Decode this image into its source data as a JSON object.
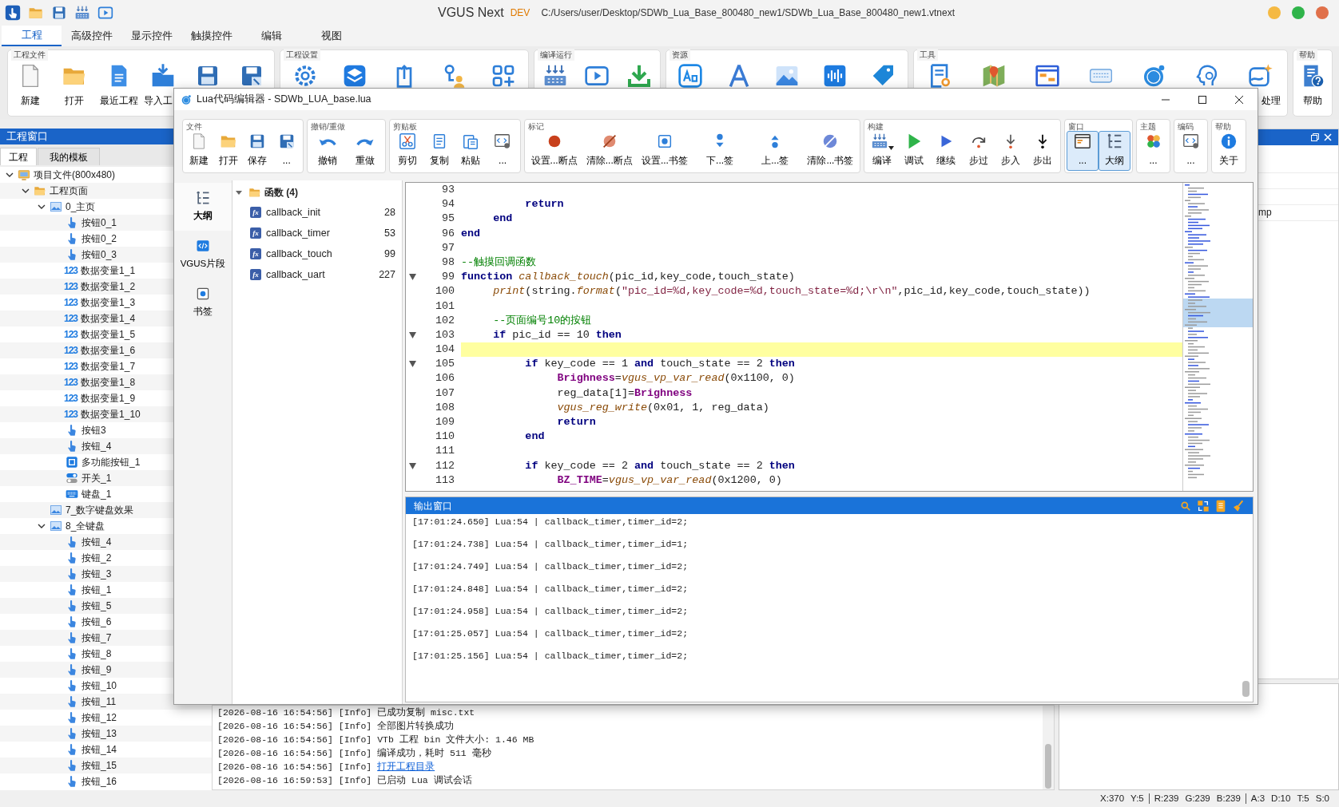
{
  "app": {
    "title": "VGUS Next",
    "badge": "DEV",
    "path": "C:/Users/user/Desktop/SDWb_Lua_Base_800480_new1/SDWb_Lua_Base_800480_new1.vtnext"
  },
  "menu_tabs": [
    {
      "label": "工程",
      "selected": true
    },
    {
      "label": "高级控件",
      "selected": false
    },
    {
      "label": "显示控件",
      "selected": false
    },
    {
      "label": "触摸控件",
      "selected": false
    },
    {
      "label": "编辑",
      "selected": false
    },
    {
      "label": "视图",
      "selected": false
    }
  ],
  "ribbon": [
    {
      "title": "工程文件",
      "buttons": [
        {
          "kind": "labeled",
          "label": "新建"
        },
        {
          "kind": "labeled",
          "label": "打开"
        },
        {
          "kind": "labeled",
          "label": "最近工程"
        },
        {
          "kind": "labeled",
          "label": "导入工"
        },
        {
          "kind": "icon"
        },
        {
          "kind": "icon"
        }
      ]
    },
    {
      "title": "工程设置",
      "buttons": [
        {
          "kind": "icon"
        },
        {
          "kind": "icon"
        },
        {
          "kind": "icon"
        },
        {
          "kind": "icon"
        },
        {
          "kind": "icon"
        }
      ]
    },
    {
      "title": "编译运行",
      "buttons": [
        {
          "kind": "icon"
        },
        {
          "kind": "icon"
        },
        {
          "kind": "icon"
        }
      ]
    },
    {
      "title": "资源",
      "buttons": [
        {
          "kind": "icon"
        },
        {
          "kind": "icon"
        },
        {
          "kind": "icon"
        },
        {
          "kind": "icon"
        },
        {
          "kind": "icon"
        }
      ]
    },
    {
      "title": "工具",
      "buttons": [
        {
          "kind": "icon"
        },
        {
          "kind": "icon"
        },
        {
          "kind": "icon"
        },
        {
          "kind": "icon"
        },
        {
          "kind": "icon"
        },
        {
          "kind": "icon"
        },
        {
          "kind": "labeled",
          "label": "处理"
        }
      ]
    },
    {
      "title": "帮助",
      "buttons": [
        {
          "kind": "labeled",
          "label": "帮助"
        }
      ]
    }
  ],
  "project_panel": {
    "title": "工程窗口",
    "tabs": [
      {
        "label": "工程",
        "selected": true
      },
      {
        "label": "我的模板",
        "selected": false
      }
    ],
    "tree": [
      {
        "kind": "project",
        "label": "项目文件(800x480)",
        "expanded": true,
        "children": [
          {
            "kind": "folder",
            "label": "工程页面",
            "expanded": true,
            "children": [
              {
                "kind": "page",
                "label": "0_主页",
                "expanded": true,
                "children": [
                  {
                    "kind": "button",
                    "label": "按钮0_1"
                  },
                  {
                    "kind": "button",
                    "label": "按钮0_2"
                  },
                  {
                    "kind": "button",
                    "label": "按钮0_3"
                  },
                  {
                    "kind": "number",
                    "badge": "123",
                    "label": "数据变量1_1"
                  },
                  {
                    "kind": "number",
                    "badge": "123",
                    "label": "数据变量1_2"
                  },
                  {
                    "kind": "number",
                    "badge": "123",
                    "label": "数据变量1_3"
                  },
                  {
                    "kind": "number",
                    "badge": "123",
                    "label": "数据变量1_4"
                  },
                  {
                    "kind": "number",
                    "badge": "123",
                    "label": "数据变量1_5"
                  },
                  {
                    "kind": "number",
                    "badge": "123",
                    "label": "数据变量1_6"
                  },
                  {
                    "kind": "number",
                    "badge": "123",
                    "label": "数据变量1_7"
                  },
                  {
                    "kind": "number",
                    "badge": "123",
                    "label": "数据变量1_8"
                  },
                  {
                    "kind": "number",
                    "badge": "123",
                    "label": "数据变量1_9"
                  },
                  {
                    "kind": "number",
                    "badge": "123",
                    "label": "数据变量1_10"
                  },
                  {
                    "kind": "button",
                    "label": "按钮3"
                  },
                  {
                    "kind": "button",
                    "label": "按钮_4"
                  },
                  {
                    "kind": "multi",
                    "label": "多功能按钮_1"
                  },
                  {
                    "kind": "switch",
                    "label": "开关_1"
                  },
                  {
                    "kind": "keyboard",
                    "label": "键盘_1"
                  }
                ]
              },
              {
                "kind": "page",
                "label": "7_数字键盘效果"
              },
              {
                "kind": "page",
                "label": "8_全键盘",
                "expanded": true,
                "children": [
                  {
                    "kind": "button",
                    "label": "按钮_4"
                  },
                  {
                    "kind": "button",
                    "label": "按钮_2"
                  },
                  {
                    "kind": "button",
                    "label": "按钮_3"
                  },
                  {
                    "kind": "button",
                    "label": "按钮_1"
                  },
                  {
                    "kind": "button",
                    "label": "按钮_5"
                  },
                  {
                    "kind": "button",
                    "label": "按钮_6"
                  },
                  {
                    "kind": "button",
                    "label": "按钮_7"
                  },
                  {
                    "kind": "button",
                    "label": "按钮_8"
                  },
                  {
                    "kind": "button",
                    "label": "按钮_9"
                  },
                  {
                    "kind": "button",
                    "label": "按钮_10"
                  },
                  {
                    "kind": "button",
                    "label": "按钮_11"
                  },
                  {
                    "kind": "button",
                    "label": "按钮_12"
                  },
                  {
                    "kind": "button",
                    "label": "按钮_13"
                  },
                  {
                    "kind": "button",
                    "label": "按钮_14"
                  },
                  {
                    "kind": "button",
                    "label": "按钮_15"
                  },
                  {
                    "kind": "button",
                    "label": "按钮_16"
                  }
                ]
              }
            ]
          }
        ]
      }
    ]
  },
  "properties_panel": {
    "rows": [
      {
        "value": "mp"
      }
    ]
  },
  "log": [
    {
      "kind": "text",
      "time": "[2026-08-16 16:54:56]",
      "level": "[Info]",
      "text": "已成功复制 misc.txt"
    },
    {
      "kind": "text",
      "time": "[2026-08-16 16:54:56]",
      "level": "[Info]",
      "text": "全部图片转换成功"
    },
    {
      "kind": "text",
      "time": "[2026-08-16 16:54:56]",
      "level": "[Info]",
      "text": "VTb 工程 bin 文件大小: 1.46 MB"
    },
    {
      "kind": "text",
      "time": "[2026-08-16 16:54:56]",
      "level": "[Info]",
      "text": "编译成功，耗时 511 毫秒"
    },
    {
      "kind": "link",
      "time": "[2026-08-16 16:54:56]",
      "level": "[Info]",
      "text": "打开工程目录"
    },
    {
      "kind": "text",
      "time": "[2026-08-16 16:59:53]",
      "level": "[Info]",
      "text": "已启动 Lua 调试会话"
    }
  ],
  "status_bar": [
    {
      "items": [
        "X:370",
        "Y:5"
      ]
    },
    {
      "items": [
        "R:239",
        "G:239",
        "B:239"
      ]
    },
    {
      "items": [
        "A:3",
        "D:10",
        "T:5",
        "S:0"
      ]
    }
  ],
  "editor": {
    "title": "Lua代码编辑器 - SDWb_LUA_base.lua",
    "toolbar": [
      {
        "title": "文件",
        "buttons": [
          {
            "label": "新建"
          },
          {
            "label": "打开"
          },
          {
            "label": "保存"
          },
          {
            "label": "..."
          }
        ]
      },
      {
        "title": "撤销/重做",
        "buttons": [
          {
            "label": "撤销"
          },
          {
            "label": "重做"
          }
        ]
      },
      {
        "title": "剪贴板",
        "buttons": [
          {
            "label": "剪切"
          },
          {
            "label": "复制"
          },
          {
            "label": "粘贴"
          },
          {
            "label": "..."
          }
        ]
      },
      {
        "title": "标记",
        "buttons": [
          {
            "label": "设置...断点"
          },
          {
            "label": "清除...断点"
          },
          {
            "label": "设置...书签"
          },
          {
            "label": "下...签"
          },
          {
            "label": "上...签"
          },
          {
            "label": "清除...书签"
          }
        ]
      },
      {
        "title": "构建",
        "buttons": [
          {
            "label": "编译",
            "kind": "split"
          },
          {
            "label": "调试",
            "kind": "plain"
          },
          {
            "label": "继续",
            "kind": "plain"
          },
          {
            "label": "步过",
            "kind": "plain"
          },
          {
            "label": "步入",
            "kind": "plain"
          },
          {
            "label": "步出",
            "kind": "plain"
          }
        ]
      },
      {
        "title": "窗口",
        "buttons": [
          {
            "label": "...",
            "selected": true
          },
          {
            "label": "大纲",
            "selected": true
          }
        ]
      },
      {
        "title": "主题",
        "buttons": [
          {
            "label": "..."
          }
        ]
      },
      {
        "title": "编码",
        "buttons": [
          {
            "label": "..."
          }
        ]
      },
      {
        "title": "帮助",
        "buttons": [
          {
            "label": "关于"
          }
        ]
      }
    ],
    "side_tabs": [
      {
        "label": "大纲",
        "selected": true
      },
      {
        "label": "VGUS片段",
        "selected": false
      },
      {
        "label": "书签",
        "selected": false
      }
    ],
    "outline": {
      "label": "函数 (4)",
      "expanded": true,
      "items": [
        {
          "badge": "fx",
          "name": "callback_init",
          "line": "28"
        },
        {
          "badge": "fx",
          "name": "callback_timer",
          "line": "53"
        },
        {
          "badge": "fx",
          "name": "callback_touch",
          "line": "99"
        },
        {
          "badge": "fx",
          "name": "callback_uart",
          "line": "227"
        }
      ]
    },
    "code": [
      {
        "number": "93",
        "foldable": false,
        "current": false
      },
      {
        "number": "94",
        "foldable": false,
        "current": false,
        "tokens": [
          {
            "kind": "keyword",
            "text": "          return"
          }
        ]
      },
      {
        "number": "95",
        "foldable": false,
        "current": false,
        "tokens": [
          {
            "kind": "keyword",
            "text": "     end"
          }
        ]
      },
      {
        "number": "96",
        "foldable": false,
        "current": false,
        "tokens": [
          {
            "kind": "keyword",
            "text": "end"
          }
        ]
      },
      {
        "number": "97",
        "foldable": false,
        "current": false
      },
      {
        "number": "98",
        "foldable": false,
        "current": false,
        "tokens": [
          {
            "kind": "comment",
            "text": "--触摸回调函数"
          }
        ]
      },
      {
        "number": "99",
        "foldable": true,
        "current": false,
        "tokens": [
          {
            "kind": "keyword",
            "text": "function "
          },
          {
            "kind": "function",
            "text": "callback_touch"
          },
          {
            "kind": "plain",
            "text": "(pic_id,key_code,touch_state)"
          }
        ]
      },
      {
        "number": "100",
        "foldable": false,
        "current": false,
        "tokens": [
          {
            "kind": "function",
            "text": "     print"
          },
          {
            "kind": "plain",
            "text": "(string."
          },
          {
            "kind": "function",
            "text": "format"
          },
          {
            "kind": "plain",
            "text": "("
          },
          {
            "kind": "string",
            "text": "\"pic_id=%d,key_code=%d,touch_state=%d;\\r\\n\""
          },
          {
            "kind": "plain",
            "text": ",pic_id,key_code,touch_state))"
          }
        ]
      },
      {
        "number": "101",
        "foldable": false,
        "current": false
      },
      {
        "number": "102",
        "foldable": false,
        "current": false,
        "tokens": [
          {
            "kind": "comment",
            "text": "     --页面编号10的按钮"
          }
        ]
      },
      {
        "number": "103",
        "foldable": true,
        "current": false,
        "tokens": [
          {
            "kind": "keyword",
            "text": "     if"
          },
          {
            "kind": "plain",
            "text": " pic_id == 10 "
          },
          {
            "kind": "keyword",
            "text": "then"
          }
        ]
      },
      {
        "number": "104",
        "foldable": false,
        "current": true
      },
      {
        "number": "105",
        "foldable": true,
        "current": false,
        "tokens": [
          {
            "kind": "keyword",
            "text": "          if"
          },
          {
            "kind": "plain",
            "text": " key_code == 1 "
          },
          {
            "kind": "keyword",
            "text": "and"
          },
          {
            "kind": "plain",
            "text": " touch_state == 2 "
          },
          {
            "kind": "keyword",
            "text": "then"
          }
        ]
      },
      {
        "number": "106",
        "foldable": false,
        "current": false,
        "tokens": [
          {
            "kind": "variable",
            "text": "               Brighness"
          },
          {
            "kind": "plain",
            "text": "="
          },
          {
            "kind": "function",
            "text": "vgus_vp_var_read"
          },
          {
            "kind": "plain",
            "text": "(0x1100, 0)"
          }
        ]
      },
      {
        "number": "107",
        "foldable": false,
        "current": false,
        "tokens": [
          {
            "kind": "plain",
            "text": "               reg_data[1]="
          },
          {
            "kind": "variable",
            "text": "Brighness"
          }
        ]
      },
      {
        "number": "108",
        "foldable": false,
        "current": false,
        "tokens": [
          {
            "kind": "function",
            "text": "               vgus_reg_write"
          },
          {
            "kind": "plain",
            "text": "(0x01, 1, reg_data)"
          }
        ]
      },
      {
        "number": "109",
        "foldable": false,
        "current": false,
        "tokens": [
          {
            "kind": "keyword",
            "text": "               return"
          }
        ]
      },
      {
        "number": "110",
        "foldable": false,
        "current": false,
        "tokens": [
          {
            "kind": "keyword",
            "text": "          end"
          }
        ]
      },
      {
        "number": "111",
        "foldable": false,
        "current": false
      },
      {
        "number": "112",
        "foldable": true,
        "current": false,
        "tokens": [
          {
            "kind": "keyword",
            "text": "          if"
          },
          {
            "kind": "plain",
            "text": " key_code == 2 "
          },
          {
            "kind": "keyword",
            "text": "and"
          },
          {
            "kind": "plain",
            "text": " touch_state == 2 "
          },
          {
            "kind": "keyword",
            "text": "then"
          }
        ]
      },
      {
        "number": "113",
        "foldable": false,
        "current": false,
        "tokens": [
          {
            "kind": "variable",
            "text": "               BZ_TIME"
          },
          {
            "kind": "plain",
            "text": "="
          },
          {
            "kind": "function",
            "text": "vgus_vp_var_read"
          },
          {
            "kind": "plain",
            "text": "(0x1200, 0)"
          }
        ]
      }
    ],
    "output": {
      "title": "输出窗口",
      "lines": [
        "[17:01:24.650] Lua:54 | callback_timer,timer_id=2;",
        "[17:01:24.738] Lua:54 | callback_timer,timer_id=1;",
        "[17:01:24.749] Lua:54 | callback_timer,timer_id=2;",
        "[17:01:24.848] Lua:54 | callback_timer,timer_id=2;",
        "[17:01:24.958] Lua:54 | callback_timer,timer_id=2;",
        "[17:01:25.057] Lua:54 | callback_timer,timer_id=2;",
        "[17:01:25.156] Lua:54 | callback_timer,timer_id=2;"
      ]
    }
  }
}
